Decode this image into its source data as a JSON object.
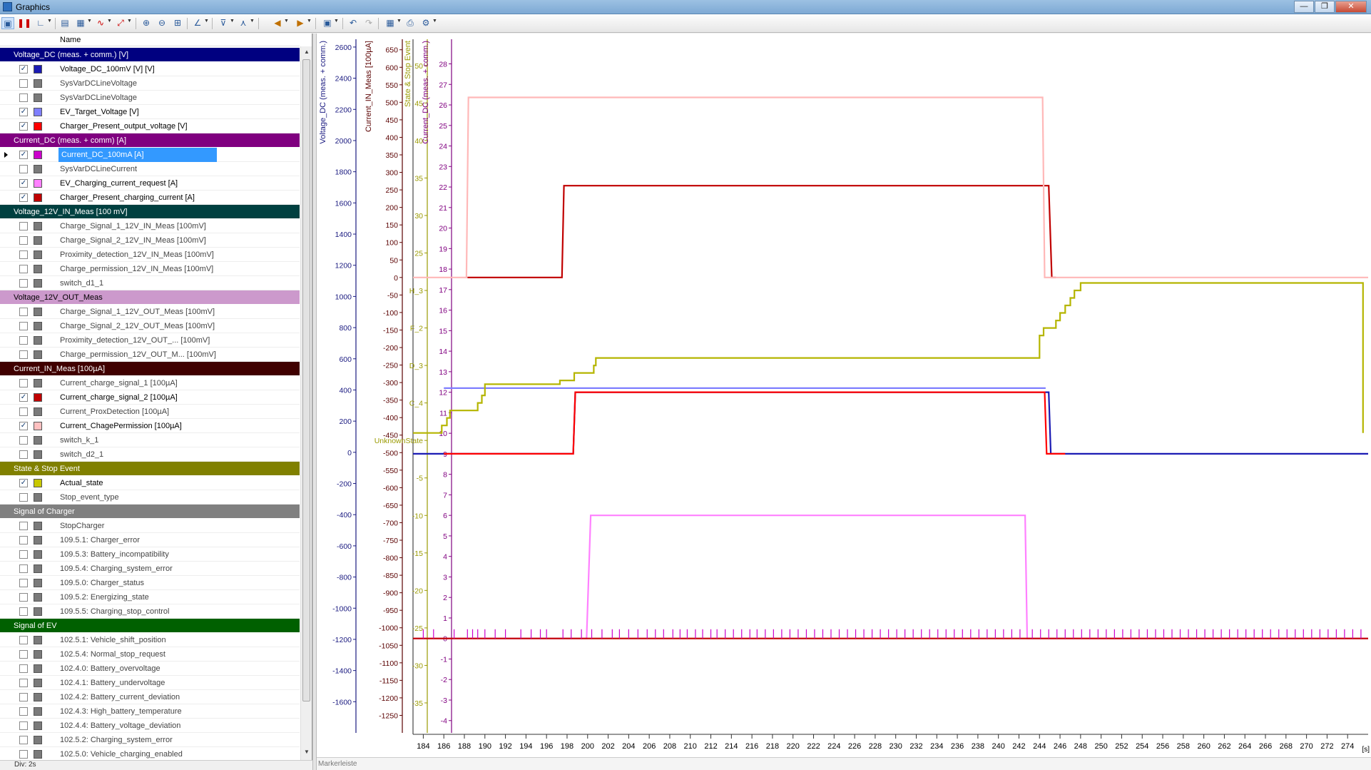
{
  "window": {
    "title": "Graphics",
    "minimize_icon": "minimize-icon",
    "maximize_icon": "restore-icon",
    "close_icon": "close-icon"
  },
  "toolbar": {
    "icons": [
      "graphics-layout-icon",
      "pause-icon",
      "axis-icon",
      "zoom-in-icon",
      "zoom-out-icon",
      "signal-icon",
      "fit-icon",
      "zoom-x-icon",
      "zoom-y-icon",
      "zoom-box-icon",
      "measure-icon",
      "marker-icon",
      "marker2-icon",
      "left-icon",
      "right-icon",
      "layout-icon",
      "undo-icon",
      "redo-icon",
      "export-icon",
      "print-icon",
      "settings-icon"
    ]
  },
  "left_panel": {
    "column_header": "Name",
    "groups": [
      {
        "label": "Voltage_DC (meas. + comm.) [V]",
        "color": "#000080",
        "items": [
          {
            "label": "Voltage_DC_100mV [V] [V]",
            "checked": true,
            "color": "#1a1ab3"
          },
          {
            "label": "SysVarDCLineVoltage",
            "checked": false,
            "color": "#7a7a7a"
          },
          {
            "label": "SysVarDCLineVoltage",
            "checked": false,
            "color": "#7a7a7a"
          },
          {
            "label": "EV_Target_Voltage [V]",
            "checked": true,
            "color": "#7f7fff"
          },
          {
            "label": "Charger_Present_output_voltage [V]",
            "checked": true,
            "color": "#ff0000"
          }
        ]
      },
      {
        "label": "Current_DC (meas. + comm) [A]",
        "color": "#800080",
        "items": [
          {
            "label": "Current_DC_100mA [A]",
            "checked": true,
            "color": "#cc00cc",
            "selected": true
          },
          {
            "label": "SysVarDCLineCurrent",
            "checked": false,
            "color": "#7a7a7a"
          },
          {
            "label": "EV_Charging_current_request [A]",
            "checked": true,
            "color": "#ff80ff"
          },
          {
            "label": "Charger_Present_charging_current [A]",
            "checked": true,
            "color": "#c00000"
          }
        ]
      },
      {
        "label": "Voltage_12V_IN_Meas [100 mV]",
        "color": "#004040",
        "items": [
          {
            "label": "Charge_Signal_1_12V_IN_Meas [100mV]",
            "checked": false,
            "color": "#7a7a7a"
          },
          {
            "label": "Charge_Signal_2_12V_IN_Meas [100mV]",
            "checked": false,
            "color": "#7a7a7a"
          },
          {
            "label": "Proximity_detection_12V_IN_Meas [100mV]",
            "checked": false,
            "color": "#7a7a7a"
          },
          {
            "label": "Charge_permission_12V_IN_Meas [100mV]",
            "checked": false,
            "color": "#7a7a7a"
          },
          {
            "label": "switch_d1_1",
            "checked": false,
            "color": "#7a7a7a"
          }
        ]
      },
      {
        "label": "Voltage_12V_OUT_Meas",
        "color": "#cc99cc",
        "dark_text": true,
        "items": [
          {
            "label": "Charge_Signal_1_12V_OUT_Meas [100mV]",
            "checked": false,
            "color": "#7a7a7a"
          },
          {
            "label": "Charge_Signal_2_12V_OUT_Meas [100mV]",
            "checked": false,
            "color": "#7a7a7a"
          },
          {
            "label": "Proximity_detection_12V_OUT_... [100mV]",
            "checked": false,
            "color": "#7a7a7a"
          },
          {
            "label": "Charge_permission_12V_OUT_M... [100mV]",
            "checked": false,
            "color": "#7a7a7a"
          }
        ]
      },
      {
        "label": "Current_IN_Meas [100µA]",
        "color": "#400000",
        "items": [
          {
            "label": "Current_charge_signal_1 [100µA]",
            "checked": false,
            "color": "#7a7a7a"
          },
          {
            "label": "Current_charge_signal_2 [100µA]",
            "checked": true,
            "color": "#c00000"
          },
          {
            "label": "Current_ProxDetection [100µA]",
            "checked": false,
            "color": "#7a7a7a"
          },
          {
            "label": "Current_ChagePermission [100µA]",
            "checked": true,
            "color": "#ffc0c0"
          },
          {
            "label": "switch_k_1",
            "checked": false,
            "color": "#7a7a7a"
          },
          {
            "label": "switch_d2_1",
            "checked": false,
            "color": "#7a7a7a"
          }
        ]
      },
      {
        "label": "State & Stop Event",
        "color": "#808000",
        "items": [
          {
            "label": "Actual_state",
            "checked": true,
            "color": "#c8c800"
          },
          {
            "label": "Stop_event_type",
            "checked": false,
            "color": "#7a7a7a"
          }
        ]
      },
      {
        "label": "Signal of Charger",
        "color": "#808080",
        "items": [
          {
            "label": "StopCharger",
            "checked": false,
            "color": "#7a7a7a"
          },
          {
            "label": "109.5.1: Charger_error",
            "checked": false,
            "color": "#7a7a7a"
          },
          {
            "label": "109.5.3: Battery_incompatibility",
            "checked": false,
            "color": "#7a7a7a"
          },
          {
            "label": "109.5.4: Charging_system_error",
            "checked": false,
            "color": "#7a7a7a"
          },
          {
            "label": "109.5.0: Charger_status",
            "checked": false,
            "color": "#7a7a7a"
          },
          {
            "label": "109.5.2: Energizing_state",
            "checked": false,
            "color": "#7a7a7a"
          },
          {
            "label": "109.5.5: Charging_stop_control",
            "checked": false,
            "color": "#7a7a7a"
          }
        ]
      },
      {
        "label": "Signal of EV",
        "color": "#006000",
        "items": [
          {
            "label": "102.5.1: Vehicle_shift_position",
            "checked": false,
            "color": "#7a7a7a"
          },
          {
            "label": "102.5.4: Normal_stop_request",
            "checked": false,
            "color": "#7a7a7a"
          },
          {
            "label": "102.4.0: Battery_overvoltage",
            "checked": false,
            "color": "#7a7a7a"
          },
          {
            "label": "102.4.1: Battery_undervoltage",
            "checked": false,
            "color": "#7a7a7a"
          },
          {
            "label": "102.4.2: Battery_current_deviation",
            "checked": false,
            "color": "#7a7a7a"
          },
          {
            "label": "102.4.3: High_battery_temperature",
            "checked": false,
            "color": "#7a7a7a"
          },
          {
            "label": "102.4.4: Battery_voltage_deviation",
            "checked": false,
            "color": "#7a7a7a"
          },
          {
            "label": "102.5.2: Charging_system_error",
            "checked": false,
            "color": "#7a7a7a"
          },
          {
            "label": "102.5.0: Vehicle_charging_enabled",
            "checked": false,
            "color": "#7a7a7a"
          }
        ]
      }
    ]
  },
  "status": {
    "div_label": "Div: 2s"
  },
  "marker_bar": {
    "label": "Markerleiste"
  },
  "chart_data": {
    "type": "line",
    "x_unit": "[s]",
    "xlim": [
      183,
      276
    ],
    "x_ticks": [
      184,
      186,
      188,
      190,
      192,
      194,
      196,
      198,
      200,
      202,
      204,
      206,
      208,
      210,
      212,
      214,
      216,
      218,
      220,
      222,
      224,
      226,
      228,
      230,
      232,
      234,
      236,
      238,
      240,
      242,
      244,
      246,
      248,
      250,
      252,
      254,
      256,
      258,
      260,
      262,
      264,
      266,
      268,
      270,
      272,
      274
    ],
    "axes": [
      {
        "id": "vdc",
        "label": "Voltage_DC (meas. + comm.)",
        "color": "#1a1a80",
        "min": -1800,
        "max": 2650,
        "ticks": [
          -1600,
          -1400,
          -1200,
          -1000,
          -800,
          -600,
          -400,
          -200,
          0,
          200,
          400,
          600,
          800,
          1000,
          1200,
          1400,
          1600,
          1800,
          2000,
          2200,
          2400,
          2600
        ]
      },
      {
        "id": "iin",
        "label": "Current_IN_Meas [100µA]",
        "color": "#5a0000",
        "min": -1300,
        "max": 680,
        "ticks": [
          -1250,
          -1200,
          -1150,
          -1100,
          -1050,
          -1000,
          -950,
          -900,
          -850,
          -800,
          -750,
          -700,
          -650,
          -600,
          -550,
          -500,
          -450,
          -400,
          -350,
          -300,
          -250,
          -200,
          -150,
          -100,
          -50,
          0,
          50,
          100,
          150,
          200,
          250,
          300,
          350,
          400,
          450,
          500,
          550,
          600,
          650
        ]
      },
      {
        "id": "state",
        "label": "State & Stop Event",
        "color": "#9a9a00",
        "min": -39,
        "max": 53.5,
        "ticks": [
          -35,
          -30,
          -25,
          -20,
          -15,
          -10,
          -5,
          0,
          5,
          10,
          15,
          20,
          25,
          30,
          35,
          40,
          45,
          50
        ],
        "tick_labels": [
          {
            "value": 0,
            "text": "UnknownState"
          },
          {
            "value": 5,
            "text": "C_4"
          },
          {
            "value": 10,
            "text": "D_3"
          },
          {
            "value": 15,
            "text": "F_2"
          },
          {
            "value": 20,
            "text": "H_3"
          }
        ]
      },
      {
        "id": "idc",
        "label": "Current_DC (meas. + comm.)",
        "color": "#800080",
        "min": -4.6,
        "max": 29.2,
        "ticks": [
          -4,
          -3,
          -2,
          -1,
          0,
          1,
          2,
          3,
          4,
          5,
          6,
          7,
          8,
          9,
          10,
          11,
          12,
          13,
          14,
          15,
          16,
          17,
          18,
          19,
          20,
          21,
          22,
          23,
          24,
          25,
          26,
          27,
          28
        ]
      }
    ],
    "series": [
      {
        "name": "Voltage_DC_100mV [V] [V]",
        "axis": "idc",
        "color": "#1a1ab3",
        "points": [
          [
            183,
            9
          ],
          [
            198.6,
            9
          ],
          [
            198.8,
            12
          ],
          [
            244.9,
            12
          ],
          [
            245.1,
            9
          ],
          [
            276,
            9
          ]
        ]
      },
      {
        "name": "EV_Target_Voltage [V]",
        "axis": "idc",
        "color": "#7f7fff",
        "points": [
          [
            186,
            12.2
          ],
          [
            244.6,
            12.2
          ]
        ]
      },
      {
        "name": "Charger_Present_output_voltage [V]",
        "axis": "idc",
        "color": "#ff0000",
        "points": [
          [
            186,
            9
          ],
          [
            198.6,
            9
          ],
          [
            198.8,
            12
          ],
          [
            244.5,
            12
          ],
          [
            244.7,
            9
          ],
          [
            246.5,
            9
          ]
        ]
      },
      {
        "name": "EV_Charging_current_request [A]",
        "axis": "idc",
        "color": "#ff80ff",
        "points": [
          [
            183,
            0
          ],
          [
            199.9,
            0
          ],
          [
            200.3,
            6
          ],
          [
            242.6,
            6
          ],
          [
            242.8,
            0
          ],
          [
            276,
            0
          ]
        ]
      },
      {
        "name": "Charger_Present_charging_current [A]",
        "axis": "idc",
        "color": "#c00000",
        "points": [
          [
            183,
            0
          ],
          [
            276,
            0
          ]
        ]
      },
      {
        "name": "Current_charge_signal_2 [100µA]",
        "axis": "iin",
        "color": "#c00000",
        "points": [
          [
            188.3,
            0
          ],
          [
            197.5,
            0
          ],
          [
            197.7,
            262
          ],
          [
            244.9,
            262
          ],
          [
            245.2,
            0
          ],
          [
            245.6,
            0
          ]
        ]
      },
      {
        "name": "Current_ChagePermission [100µA]",
        "axis": "iin",
        "color": "#ffb8b8",
        "points": [
          [
            183,
            0
          ],
          [
            188.2,
            0
          ],
          [
            188.4,
            514
          ],
          [
            244.3,
            514
          ],
          [
            244.5,
            0
          ],
          [
            276,
            0
          ]
        ]
      },
      {
        "name": "Actual_state",
        "axis": "state",
        "color": "#b5b500",
        "points": [
          [
            183,
            1
          ],
          [
            185.8,
            1
          ],
          [
            185.8,
            2
          ],
          [
            186.3,
            2
          ],
          [
            186.3,
            3
          ],
          [
            186.6,
            3
          ],
          [
            186.6,
            4
          ],
          [
            189.3,
            4
          ],
          [
            189.3,
            5
          ],
          [
            189.7,
            5
          ],
          [
            189.7,
            6
          ],
          [
            190,
            6
          ],
          [
            190,
            7.5
          ],
          [
            197.3,
            7.5
          ],
          [
            197.3,
            8
          ],
          [
            198.7,
            8
          ],
          [
            198.7,
            9
          ],
          [
            200.6,
            9
          ],
          [
            200.6,
            10
          ],
          [
            200.8,
            10
          ],
          [
            200.8,
            11
          ],
          [
            244,
            11
          ],
          [
            244,
            14
          ],
          [
            244.4,
            14
          ],
          [
            244.4,
            15
          ],
          [
            245.6,
            15
          ],
          [
            245.6,
            16
          ],
          [
            246,
            16
          ],
          [
            246,
            17
          ],
          [
            246.5,
            17
          ],
          [
            246.5,
            18
          ],
          [
            247,
            18
          ],
          [
            247,
            19
          ],
          [
            247.4,
            19
          ],
          [
            247.4,
            20
          ],
          [
            248,
            20
          ],
          [
            248,
            21
          ],
          [
            275.5,
            21
          ],
          [
            275.5,
            1
          ]
        ]
      },
      {
        "name": "Current_DC_100mA [A]",
        "axis": "idc",
        "color": "#cc00cc",
        "spikes_x": [
          184,
          185,
          187,
          188.3,
          188.8,
          189.3,
          190,
          191,
          192,
          193.5,
          194.5,
          195.4,
          196,
          197.6,
          198.4,
          199.4,
          200.4,
          201.4,
          202.4,
          203.1,
          204,
          204.9,
          205.8,
          206.6,
          207.4,
          208.3,
          209,
          209.7,
          210.5,
          211.2,
          212,
          212.6,
          213.4,
          214.2,
          215,
          215.8,
          216.5,
          217.3,
          218.1,
          218.9,
          219.7,
          220.5,
          221.3,
          222.1,
          222.9,
          223.7,
          224.5,
          225.3,
          226.1,
          226.9,
          227.7,
          228.5,
          229.3,
          230.1,
          230.9,
          231.7,
          232.5,
          233.3,
          234.1,
          234.9,
          235.7,
          236.5,
          237.3,
          238.1,
          238.9,
          239.7,
          240.5,
          241.3,
          242.1,
          243.3,
          244.1,
          244.9,
          245.7,
          246.5,
          247.3,
          248.1,
          248.9,
          249.7,
          250.5,
          251.3,
          252.1,
          252.9,
          253.7,
          254.5,
          255.3,
          256.1,
          256.9,
          257.7,
          258.5,
          259.3,
          260.1,
          260.9,
          261.7,
          262.5,
          263.3,
          264.1,
          264.9,
          265.7,
          266.5,
          267.3,
          268.1,
          268.9,
          269.7,
          270.5,
          271.3,
          272.1,
          272.9,
          273.7,
          274.5,
          275.3
        ],
        "spike_level": 0.45
      }
    ]
  }
}
